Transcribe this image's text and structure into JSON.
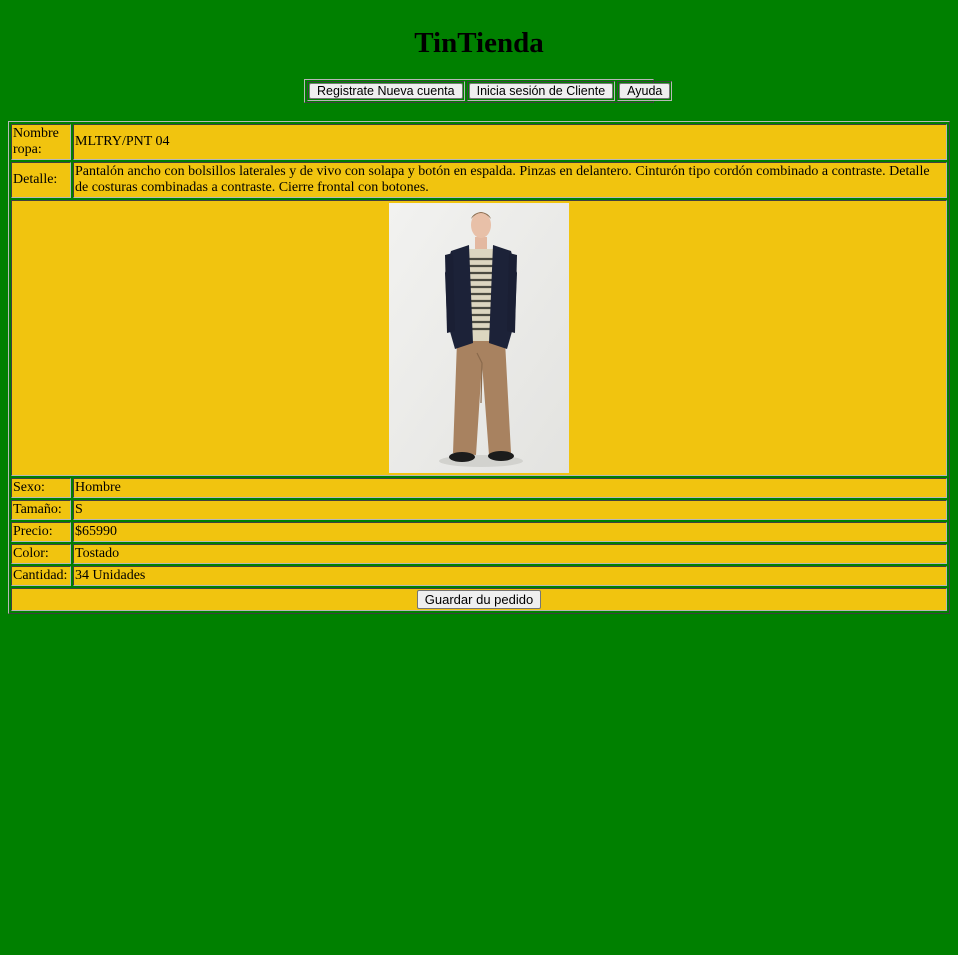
{
  "header": {
    "title": "TinTienda"
  },
  "nav": {
    "register_label": "Registrate Nueva cuenta",
    "login_label": "Inicia sesión de Cliente",
    "help_label": "Ayuda"
  },
  "product": {
    "name_label": "Nombre ropa:",
    "name_value": "MLTRY/PNT 04",
    "detail_label": "Detalle:",
    "detail_value": "Pantalón ancho con bolsillos laterales y de vivo con solapa y botón en espalda. Pinzas en delantero. Cinturón tipo cordón combinado a contraste. Detalle de costuras combinadas a contraste. Cierre frontal con botones.",
    "sex_label": "Sexo:",
    "sex_value": "Hombre",
    "size_label": "Tamaño:",
    "size_value": "S",
    "price_label": "Precio:",
    "price_value": "$65990",
    "color_label": "Color:",
    "color_value": "Tostado",
    "qty_label": "Cantidad:",
    "qty_value": "34 Unidades",
    "save_label": "Guardar du pedido"
  },
  "colors": {
    "page_background": "#008000",
    "table_cell": "#f1c40f",
    "button_face": "#efefef"
  }
}
